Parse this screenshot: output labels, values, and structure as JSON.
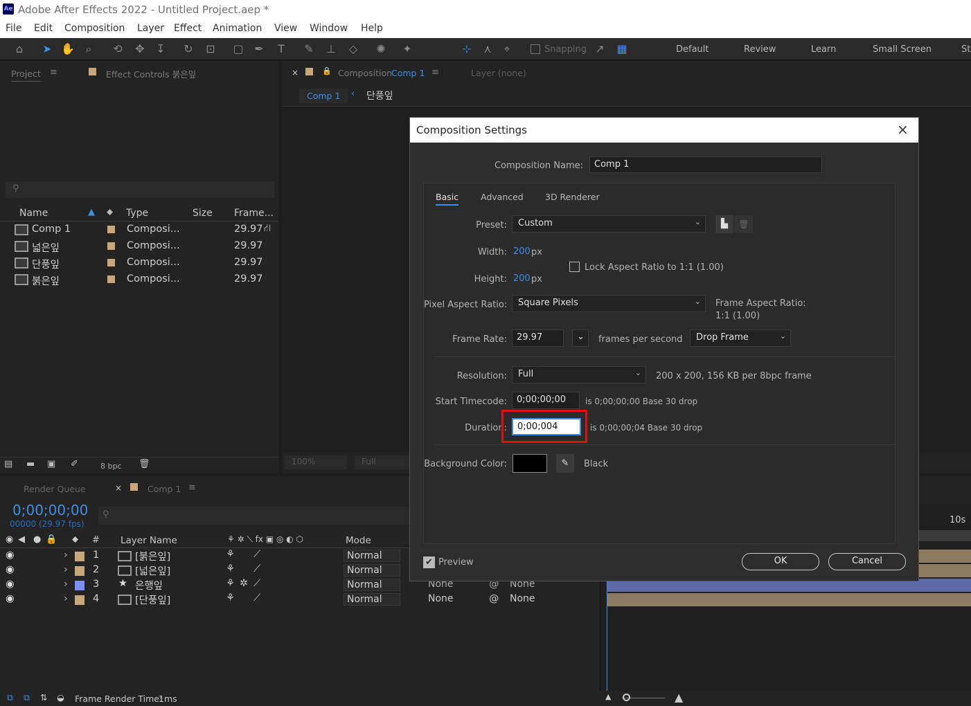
{
  "window": {
    "title": "Adobe After Effects 2022 - Untitled Project.aep *",
    "app_icon": "Ae"
  },
  "menu": [
    "File",
    "Edit",
    "Composition",
    "Layer",
    "Effect",
    "Animation",
    "View",
    "Window",
    "Help"
  ],
  "toolbar": {
    "snapping": "Snapping",
    "workspaces": [
      "Default",
      "Review",
      "Learn",
      "Small Screen",
      "St"
    ]
  },
  "project": {
    "tab": "Project",
    "effect_tab": "Effect Controls 붉은잎",
    "columns": {
      "name": "Name",
      "type": "Type",
      "size": "Size",
      "frame": "Frame..."
    },
    "items": [
      {
        "name": "Comp 1",
        "type": "Composi...",
        "frame": "29.97"
      },
      {
        "name": "넓은잎",
        "type": "Composi...",
        "frame": "29.97"
      },
      {
        "name": "단풍잎",
        "type": "Composi...",
        "frame": "29.97"
      },
      {
        "name": "붉은잎",
        "type": "Composi...",
        "frame": "29.97"
      }
    ],
    "bpc": "8 bpc"
  },
  "viewer": {
    "tab_prefix": "Composition",
    "tab_name": "Comp 1",
    "layer_tab": "Layer (none)",
    "crumb1": "Comp 1",
    "crumb2": "단풍잎",
    "zoom": "100%",
    "res": "Full"
  },
  "timeline": {
    "render_queue": "Render Queue",
    "comp_tab": "Comp 1",
    "timecode": "0;00;00;00",
    "frames": "00000 (29.97 fps)",
    "col_hash": "#",
    "col_layer": "Layer Name",
    "col_mode": "Mode",
    "ruler": "10s",
    "layers": [
      {
        "num": "1",
        "name": "[붉은잎]",
        "mode": "Normal",
        "color": "#c8a87a"
      },
      {
        "num": "2",
        "name": "[넓은잎]",
        "mode": "Normal",
        "color": "#c8a87a"
      },
      {
        "num": "3",
        "name": "은행잎",
        "mode": "Normal",
        "color": "#7c8ff0",
        "parent": "None",
        "parent2": "None"
      },
      {
        "num": "4",
        "name": "[단풍잎]",
        "mode": "Normal",
        "color": "#c8a87a",
        "parent": "None",
        "parent2": "None"
      }
    ]
  },
  "status": {
    "label": "Frame Render Time:",
    "value": "1ms"
  },
  "dialog": {
    "title": "Composition Settings",
    "name_label": "Composition Name:",
    "name_value": "Comp 1",
    "tabs": [
      "Basic",
      "Advanced",
      "3D Renderer"
    ],
    "preset_label": "Preset:",
    "preset_value": "Custom",
    "width_label": "Width:",
    "width_value": "200",
    "px": "px",
    "height_label": "Height:",
    "height_value": "200",
    "lock_label": "Lock Aspect Ratio to 1:1 (1.00)",
    "par_label": "Pixel Aspect Ratio:",
    "par_value": "Square Pixels",
    "far_label": "Frame Aspect Ratio:",
    "far_value": "1:1 (1.00)",
    "fr_label": "Frame Rate:",
    "fr_value": "29.97",
    "fps_text": "frames per second",
    "drop_value": "Drop Frame",
    "res_label": "Resolution:",
    "res_value": "Full",
    "res_info": "200 x 200, 156 KB per 8bpc frame",
    "start_label": "Start Timecode:",
    "start_value": "0;00;00;00",
    "start_info": "is 0;00;00;00  Base 30   drop",
    "dur_label": "Duration:",
    "dur_value": "0;00;004",
    "dur_info": "is 0;00;00;04  Base 30   drop",
    "bg_label": "Background Color:",
    "bg_name": "Black",
    "bg_color": "#000000",
    "preview_label": "Preview",
    "ok": "OK",
    "cancel": "Cancel"
  },
  "colors": {
    "accent": "#3d8fe6",
    "highlight": "#e01010"
  }
}
